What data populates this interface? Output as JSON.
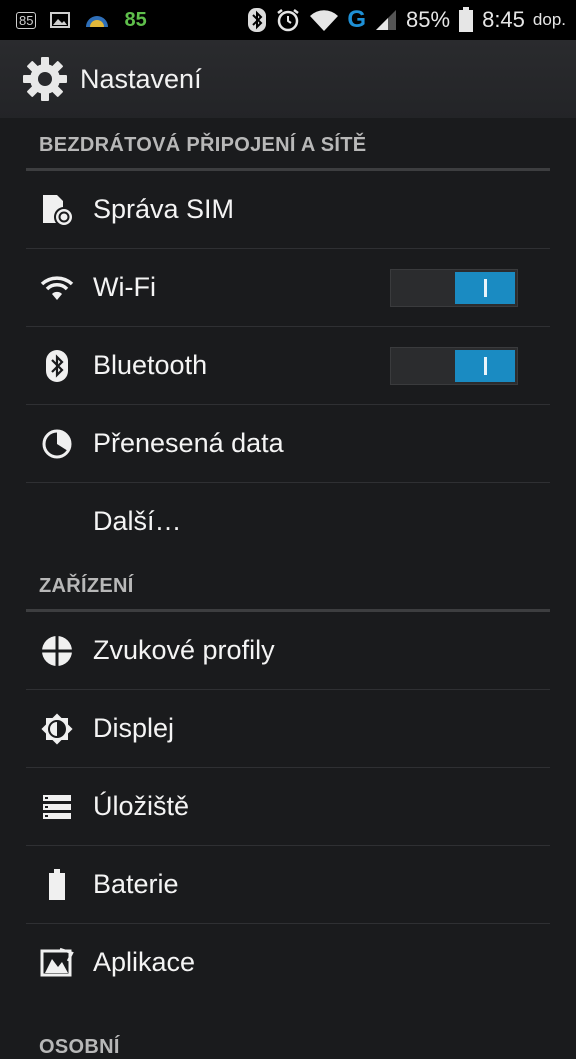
{
  "status_bar": {
    "notif_badge": "85",
    "battery_app_level": "85",
    "battery_percent": "85%",
    "network_type": "G",
    "time": "8:45",
    "ampm": "dop."
  },
  "action_bar": {
    "title": "Nastavení",
    "icon": "gear-icon"
  },
  "sections": {
    "wireless": {
      "header": "BEZDRÁTOVÁ PŘIPOJENÍ A SÍTĚ",
      "items": [
        {
          "label": "Správa SIM",
          "icon": "sim-icon"
        },
        {
          "label": "Wi-Fi",
          "icon": "wifi-icon",
          "toggle": "on"
        },
        {
          "label": "Bluetooth",
          "icon": "bluetooth-icon",
          "toggle": "on"
        },
        {
          "label": "Přenesená data",
          "icon": "data-usage-icon"
        },
        {
          "label": "Další…"
        }
      ]
    },
    "device": {
      "header": "ZAŘÍZENÍ",
      "items": [
        {
          "label": "Zvukové profily",
          "icon": "sound-profile-icon"
        },
        {
          "label": "Displej",
          "icon": "display-icon"
        },
        {
          "label": "Úložiště",
          "icon": "storage-icon"
        },
        {
          "label": "Baterie",
          "icon": "battery-icon"
        },
        {
          "label": "Aplikace",
          "icon": "apps-icon"
        }
      ]
    },
    "personal": {
      "header": "OSOBNÍ"
    }
  },
  "colors": {
    "accent": "#1a8bc2",
    "background": "#1a1b1d"
  }
}
